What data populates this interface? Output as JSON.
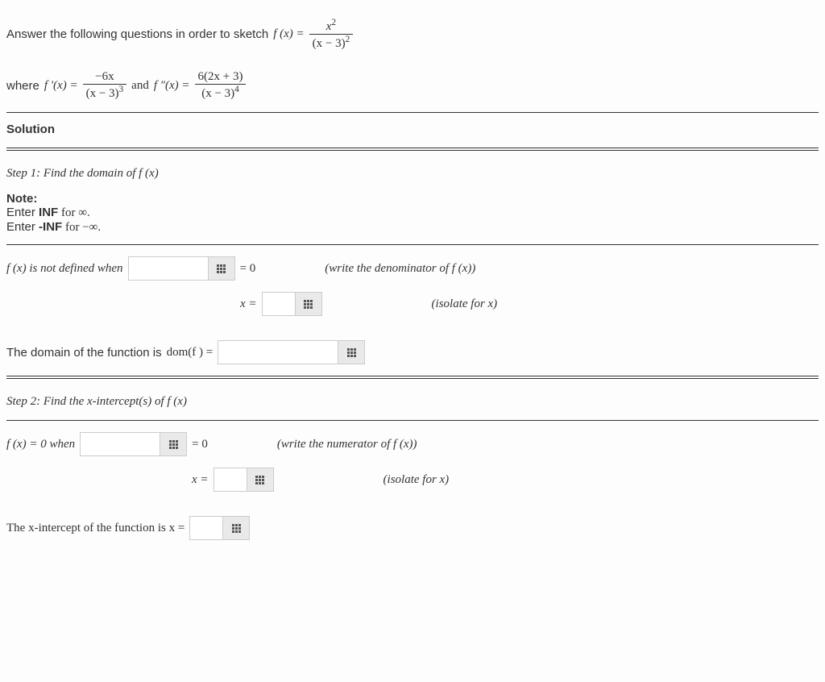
{
  "intro": {
    "prefix": "Answer the following questions in order to sketch ",
    "fx": "f (x) = ",
    "frac_num": "x",
    "frac_num_sup": "2",
    "frac_den_a": "(x − 3)",
    "frac_den_sup": "2"
  },
  "derivs": {
    "where": "where ",
    "fprime": "f ′(x) = ",
    "d1_num": "−6x",
    "d1_den_a": "(x − 3)",
    "d1_den_sup": "3",
    "and": " and ",
    "fdbl": "f ″(x) = ",
    "d2_num": "6(2x + 3)",
    "d2_den_a": "(x − 3)",
    "d2_den_sup": "4"
  },
  "solution_label": "Solution",
  "step1": {
    "title": "Step 1: Find the domain of f (x)",
    "note_label": "Note:",
    "note1a": "Enter ",
    "note1b": "INF",
    "note1c": " for ∞.",
    "note2a": "Enter ",
    "note2b": "-INF",
    "note2c": " for −∞.",
    "line1_prefix": "f (x) is not defined when",
    "eq0": "= 0",
    "hint1": "(write the denominator of f (x))",
    "xeq": "x =",
    "hint2": "(isolate for x)",
    "domain_prefix": "The domain of the function is ",
    "domf": "dom(f ) ="
  },
  "step2": {
    "title": "Step 2: Find the x-intercept(s) of f (x)",
    "line1_prefix": "f (x) = 0 when",
    "eq0": "= 0",
    "hint1": "(write the numerator of f (x))",
    "xeq": "x =",
    "hint2": "(isolate for x)",
    "xint_prefix": "The x-intercept of the function is x ="
  }
}
